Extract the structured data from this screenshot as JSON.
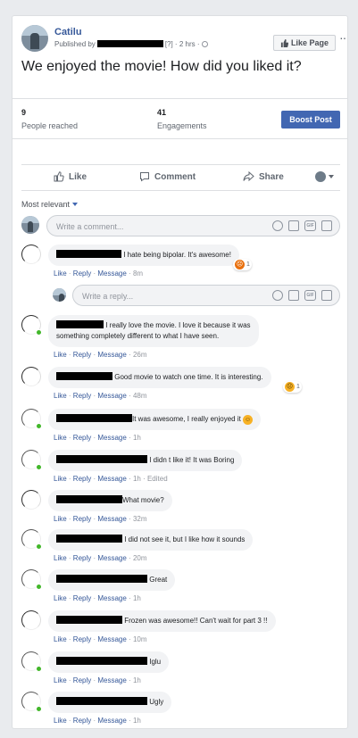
{
  "post": {
    "page_name": "Catilu",
    "published_by": "Published by",
    "published_tail": "[?] · 2 hrs ·",
    "like_page_label": "Like Page",
    "more": "···",
    "text": "We enjoyed the movie! How did you liked it?"
  },
  "stats": {
    "reach_value": "9",
    "reach_label": "People reached",
    "engagements_value": "41",
    "engagements_label": "Engagements",
    "boost_label": "Boost Post"
  },
  "actions": {
    "like": "Like",
    "comment": "Comment",
    "share": "Share"
  },
  "sort_label": "Most relevant",
  "comment_placeholder": "Write a comment...",
  "reply_placeholder": "Write a reply...",
  "meta_like": "Like",
  "meta_reply": "Reply",
  "meta_message": "Message",
  "sep": " · ",
  "comments": [
    {
      "text": "I hate being bipolar. It's awesome!",
      "time": "8m",
      "reaction_count": "1"
    },
    {
      "text": "I really love the movie. I love it because it was",
      "text2": "something completely different to what I have seen.",
      "time": "26m"
    },
    {
      "text": "Good movie to watch one time. It is interesting.",
      "time": "48m",
      "reaction_count": "1"
    },
    {
      "text": "It was awesome, I really enjoyed it",
      "time": "1h",
      "emoji": "☺"
    },
    {
      "text": "I didn t like it! It was Boring",
      "time": "1h",
      "edited": "Edited"
    },
    {
      "text": "What movie?",
      "time": "32m"
    },
    {
      "text": "I did not see it, but I like how it sounds",
      "time": "20m"
    },
    {
      "text": "Great",
      "time": "1h"
    },
    {
      "text": "Frozen was awesome!! Can't wait for part 3 !!",
      "time": "10m"
    },
    {
      "text": "Iglu",
      "time": "1h"
    },
    {
      "text": "Ugly",
      "time": "1h"
    }
  ],
  "icons": {
    "angry": "☹",
    "sad": "☹",
    "gif": "GIF"
  },
  "colors": {
    "brand": "#4267b2",
    "link": "#365899",
    "online": "#42b72a"
  }
}
